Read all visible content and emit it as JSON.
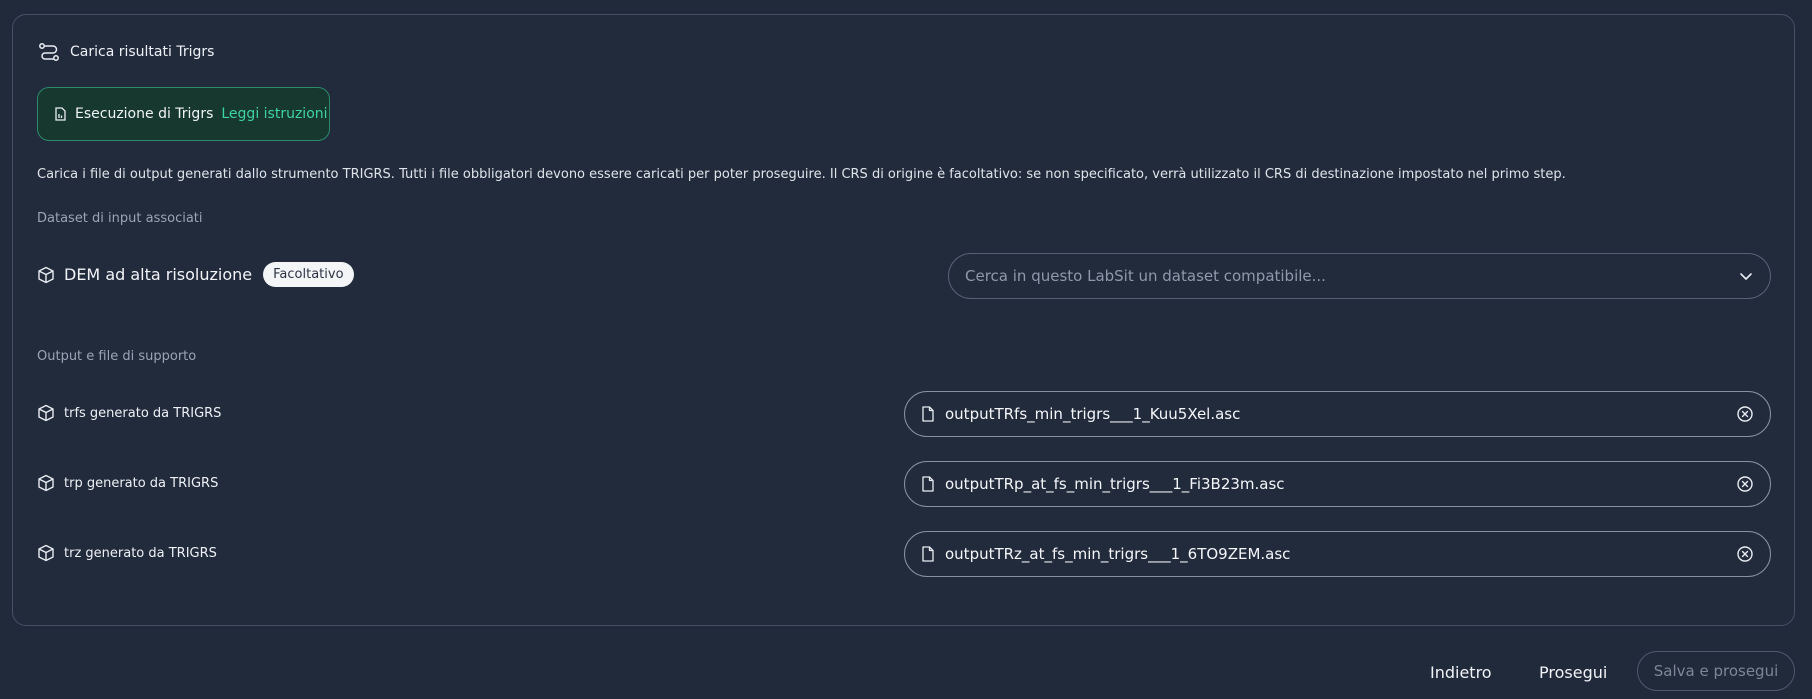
{
  "header": {
    "title": "Carica risultati Trigrs",
    "icon": "route-icon"
  },
  "instructions": {
    "label": "Esecuzione di Trigrs",
    "link": "Leggi istruzioni",
    "icon": "document-icon"
  },
  "description": "Carica i file di output generati dallo strumento TRIGRS. Tutti i file obbligatori devono essere caricati per poter proseguire. Il CRS di origine è facoltativo: se non specificato, verrà utilizzato il CRS di destinazione impostato nel primo step.",
  "input_section": {
    "label": "Dataset di input associati",
    "dem": {
      "label": "DEM ad alta risoluzione",
      "badge": "Facoltativo",
      "placeholder": "Cerca in questo LabSit un dataset compatibile..."
    }
  },
  "output_section": {
    "label": "Output e file di supporto",
    "files": [
      {
        "label": "trfs generato da TRIGRS",
        "filename": "outputTRfs_min_trigrs___1_Kuu5Xel.asc"
      },
      {
        "label": "trp generato da TRIGRS",
        "filename": "outputTRp_at_fs_min_trigrs___1_Fi3B23m.asc"
      },
      {
        "label": "trz generato da TRIGRS",
        "filename": "outputTRz_at_fs_min_trigrs___1_6TO9ZEM.asc"
      }
    ]
  },
  "footer": {
    "back": "Indietro",
    "next": "Prosegui",
    "save": "Salva e prosegui"
  },
  "colors": {
    "background": "#212a3b",
    "accent": "#3fd3a3",
    "instr_bg": "#16382f"
  }
}
